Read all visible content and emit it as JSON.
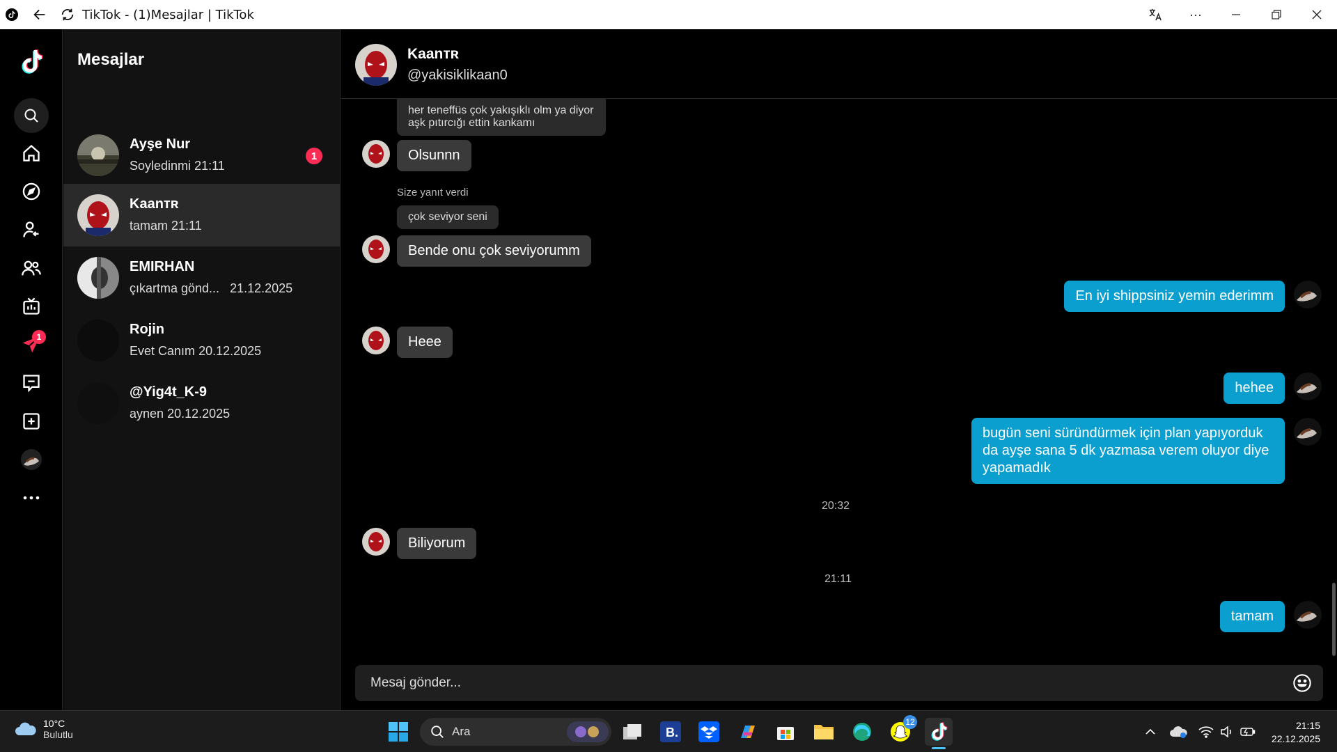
{
  "window": {
    "title": "TikTok - (1)Mesajlar | TikTok",
    "controls": [
      "translate-icon",
      "more-icon",
      "minimize",
      "restore",
      "close"
    ]
  },
  "rail": {
    "items": [
      "tiktok-logo",
      "search-icon",
      "home-icon",
      "explore-icon",
      "following-icon",
      "friends-icon",
      "live-icon",
      "messages-icon",
      "inbox-icon",
      "upload-icon",
      "profile-avatar",
      "more-icon"
    ],
    "messages_badge": "1"
  },
  "conversations": {
    "title": "Mesajlar",
    "items": [
      {
        "name": "Ayşe Nur",
        "preview": "Soyledinmi",
        "time": "21:11",
        "unread": "1"
      },
      {
        "name": "Kaanᴛʀ",
        "preview": "tamam",
        "time": "21:11"
      },
      {
        "name": "EMIRHAN",
        "preview": "çıkartma gönd...",
        "time": "21.12.2025"
      },
      {
        "name": "Rojin",
        "preview": "Evet Canım",
        "time": "20.12.2025"
      },
      {
        "name": "@Yig4t_K-9",
        "preview": "aynen",
        "time": "20.12.2025"
      }
    ]
  },
  "chat": {
    "name": "Kaanᴛʀ",
    "handle": "@yakisiklikaan0",
    "messages": {
      "quote1": "her teneffüs çok yakışıklı olm ya diyor aşk pıtırcığı ettin kankamı",
      "m1": "Olsunnn",
      "reply_label": "Size yanıt verdi",
      "quote2": "çok seviyor seni",
      "m2": "Bende onu çok seviyorumm",
      "m3": "En iyi shippsiniz yemin ederimm",
      "m4": "Heee",
      "m5": "hehee",
      "m6": "bugün seni süründürmek için plan yapıyorduk da ayşe sana 5 dk yazmasa verem oluyor diye yapamadık",
      "ts1": "20:32",
      "m7": "Biliyorum",
      "ts2": "21:11",
      "m8": "tamam"
    },
    "composer_placeholder": "Mesaj gönder..."
  },
  "taskbar": {
    "temp": "10°C",
    "condition": "Bulutlu",
    "search": "Ara",
    "notif_badge": "12",
    "time": "21:15",
    "date": "22.12.2025"
  },
  "colors": {
    "accent_out": "#0a9fcf",
    "bubble_in": "#3a3a3a",
    "badge": "#fe2c55"
  }
}
